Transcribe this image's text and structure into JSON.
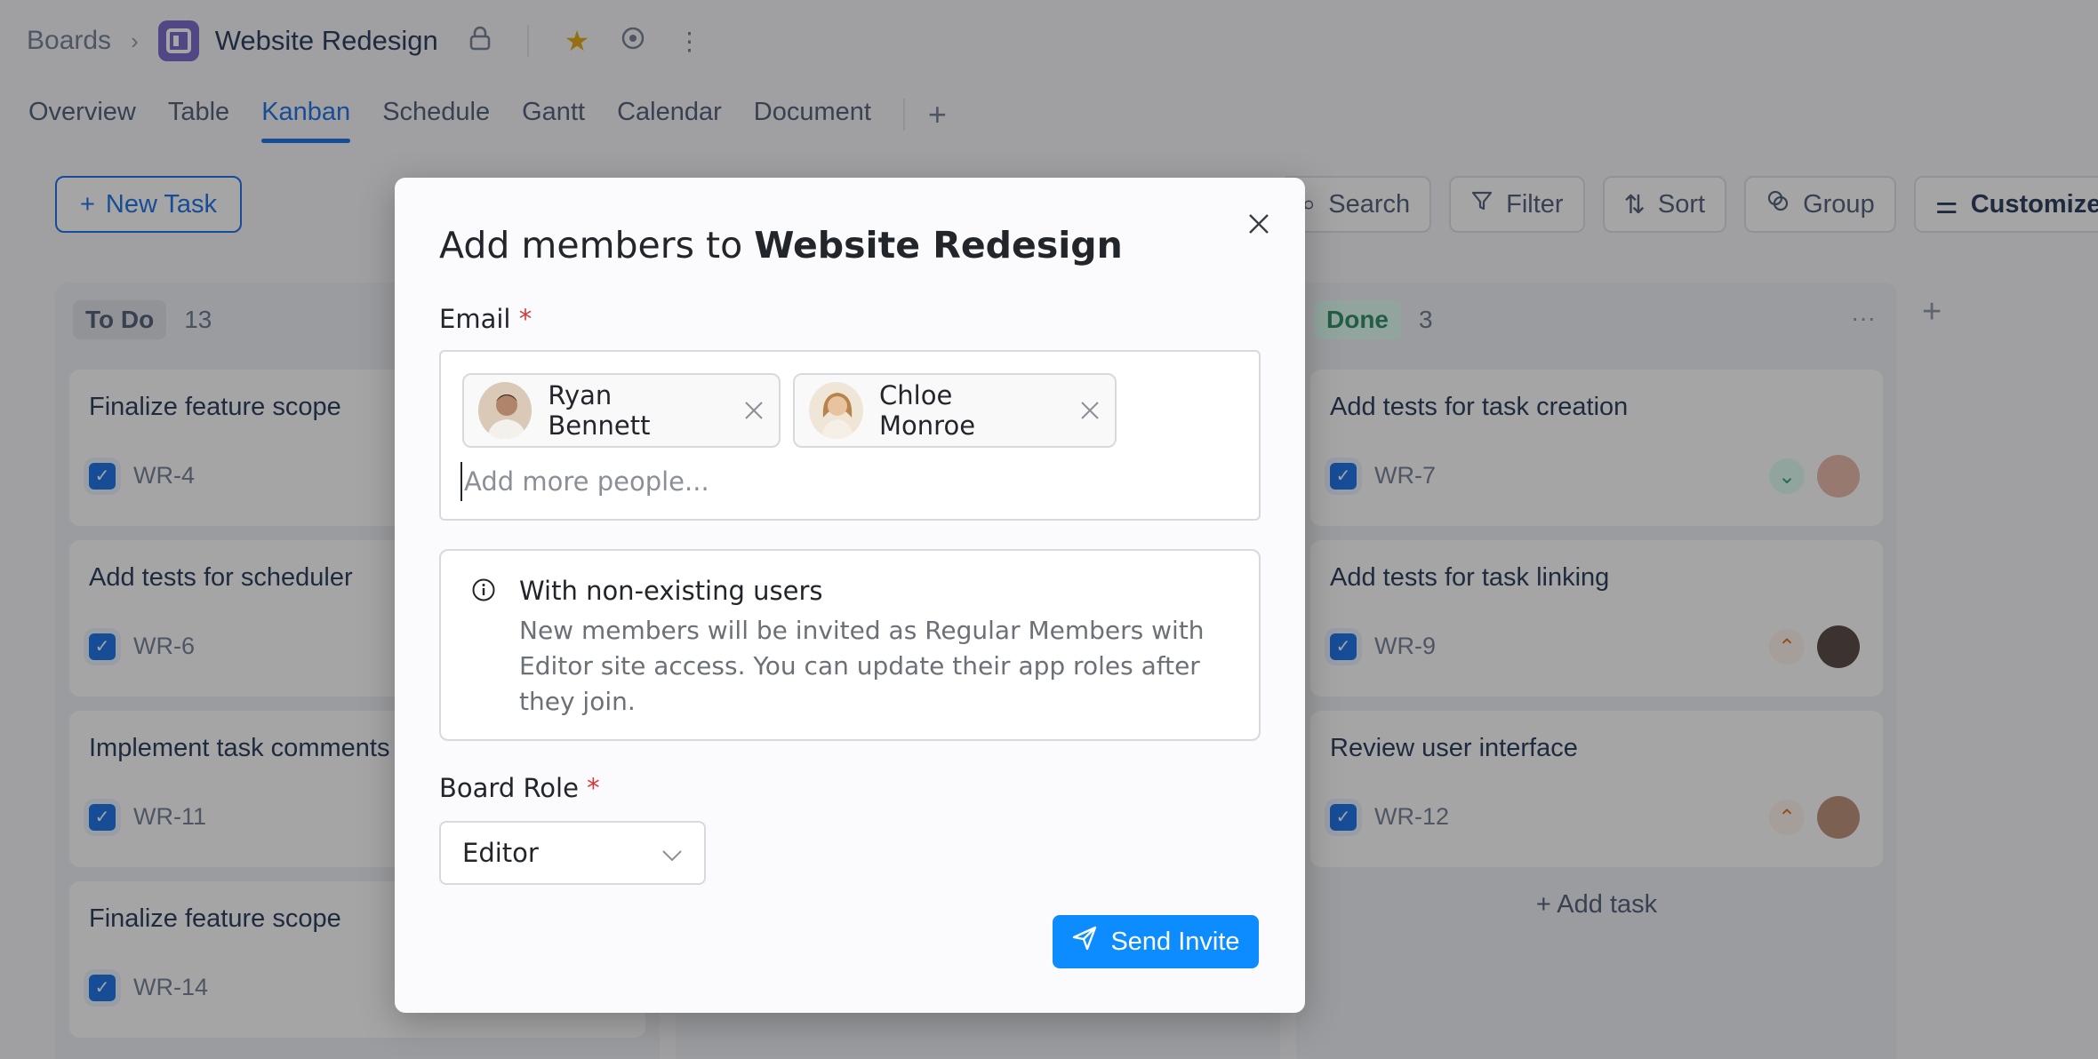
{
  "breadcrumb": {
    "root": "Boards",
    "board_name": "Website Redesign"
  },
  "tabs": [
    "Overview",
    "Table",
    "Kanban",
    "Schedule",
    "Gantt",
    "Calendar",
    "Document"
  ],
  "active_tab": "Kanban",
  "new_task_label": "New Task",
  "toolbar": {
    "search": "Search",
    "filter": "Filter",
    "sort": "Sort",
    "group": "Group",
    "customize": "Customize"
  },
  "columns": {
    "todo": {
      "name": "To Do",
      "count": "13",
      "cards": [
        {
          "title": "Finalize feature scope",
          "key": "WR-4"
        },
        {
          "title": "Add tests for scheduler",
          "key": "WR-6"
        },
        {
          "title": "Implement task comments",
          "key": "WR-11"
        },
        {
          "title": "Finalize feature scope",
          "key": "WR-14"
        }
      ]
    },
    "done": {
      "name": "Done",
      "count": "3",
      "cards": [
        {
          "title": "Add tests for task creation",
          "key": "WR-7",
          "priority": "low"
        },
        {
          "title": "Add tests for task linking",
          "key": "WR-9",
          "priority": "high"
        },
        {
          "title": "Review user interface",
          "key": "WR-12",
          "priority": "high"
        }
      ],
      "add_task": "Add task"
    }
  },
  "modal": {
    "title_prefix": "Add members to",
    "title_board": "Website Redesign",
    "email_label": "Email",
    "required_mark": "*",
    "invitees": [
      {
        "name": "Ryan Bennett"
      },
      {
        "name": "Chloe Monroe"
      }
    ],
    "input_placeholder": "Add more people...",
    "info_title": "With non-existing users",
    "info_text": "New members will be invited as Regular Members with Editor site access. You can update their app roles after they join.",
    "role_label": "Board Role",
    "role_value": "Editor",
    "send_label": "Send Invite"
  },
  "colors": {
    "accent": "#0c66e4",
    "send_button": "#0d8cff",
    "required": "#d0393b",
    "board_icon": "#6e5dc6"
  }
}
